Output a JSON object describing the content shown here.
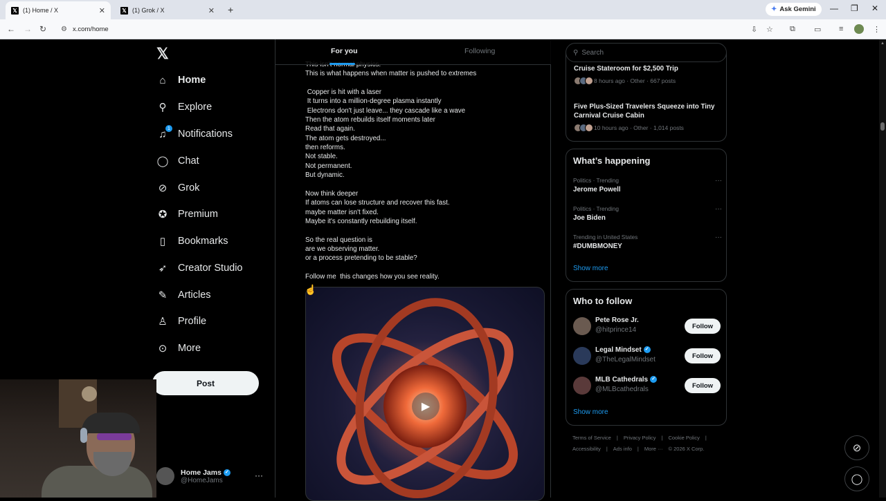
{
  "browser": {
    "tabs": [
      {
        "title": "(1) Home / X"
      },
      {
        "title": "(1) Grok / X"
      }
    ],
    "ask_gemini": "Ask Gemini",
    "url": "x.com/home"
  },
  "nav": {
    "items": [
      {
        "label": "Home",
        "icon": "home-icon"
      },
      {
        "label": "Explore",
        "icon": "search-icon"
      },
      {
        "label": "Notifications",
        "icon": "bell-icon",
        "badge": "1"
      },
      {
        "label": "Chat",
        "icon": "chat-icon"
      },
      {
        "label": "Grok",
        "icon": "grok-icon"
      },
      {
        "label": "Premium",
        "icon": "verified-icon"
      },
      {
        "label": "Bookmarks",
        "icon": "bookmark-icon"
      },
      {
        "label": "Creator Studio",
        "icon": "rocket-icon"
      },
      {
        "label": "Articles",
        "icon": "article-icon"
      },
      {
        "label": "Profile",
        "icon": "person-icon"
      },
      {
        "label": "More",
        "icon": "more-icon"
      }
    ],
    "post_button": "Post",
    "account": {
      "name": "Home Jams",
      "handle": "@HomeJams"
    }
  },
  "feed": {
    "tabs": [
      "For you",
      "Following"
    ],
    "post_lines": [
      "This isn't normal physics.",
      "This is what happens when matter is pushed to extremes",
      "",
      " Copper is hit with a laser",
      " It turns into a million-degree plasma instantly",
      " Electrons don't just leave... they cascade like a wave",
      "Then the atom rebuilds itself moments later",
      "Read that again.",
      "The atom gets destroyed...",
      "then reforms.",
      "Not stable.",
      "Not permanent.",
      "But dynamic.",
      "",
      "Now think deeper",
      "If atoms can lose structure and recover this fast.",
      "maybe matter isn't fixed.",
      "Maybe it's constantly rebuilding itself.",
      "",
      "So the real question is",
      "are we observing matter.",
      "or a process pretending to be stable?",
      "",
      "Follow me  this changes how you see reality."
    ]
  },
  "right": {
    "search_placeholder": "Search",
    "news": [
      {
        "title": "Cruise Stateroom for $2,500 Trip",
        "meta": "8 hours ago · Other · 667 posts"
      },
      {
        "title": "Five Plus-Sized Travelers Squeeze into Tiny Carnival Cruise Cabin",
        "meta": "10 hours ago · Other · 1,014 posts"
      }
    ],
    "whats_happening": {
      "heading": "What’s happening",
      "trends": [
        {
          "category": "Politics · Trending",
          "name": "Jerome Powell"
        },
        {
          "category": "Politics · Trending",
          "name": "Joe Biden"
        },
        {
          "category": "Trending in United States",
          "name": "#DUMBMONEY"
        }
      ],
      "show_more": "Show more"
    },
    "who_to_follow": {
      "heading": "Who to follow",
      "accounts": [
        {
          "name": "Pete Rose Jr.",
          "handle": "@hitprince14",
          "verified": false
        },
        {
          "name": "Legal Mindset",
          "handle": "@TheLegalMindset",
          "verified": true
        },
        {
          "name": "MLB Cathedrals",
          "handle": "@MLBcathedrals",
          "verified": true
        }
      ],
      "follow_label": "Follow",
      "show_more": "Show more"
    },
    "footer": [
      "Terms of Service",
      "|",
      "Privacy Policy",
      "|",
      "Cookie Policy",
      "|",
      "Accessibility",
      "|",
      "Ads info",
      "|",
      "More ···",
      "© 2026 X Corp."
    ]
  },
  "colors": {
    "accent": "#1d9bf0",
    "background": "#000000",
    "border": "#2f3336"
  }
}
